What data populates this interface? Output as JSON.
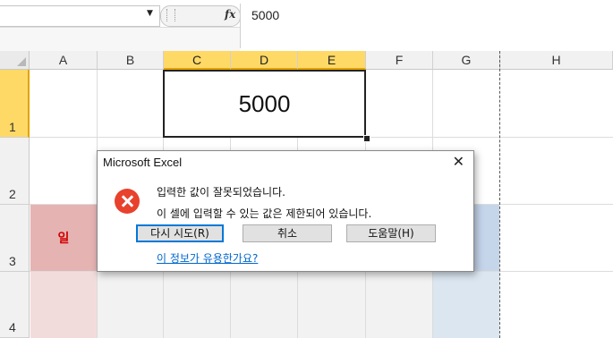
{
  "formula_bar": {
    "fx_label": "fx",
    "value": "5000"
  },
  "columns": [
    "A",
    "B",
    "C",
    "D",
    "E",
    "F",
    "G",
    "H"
  ],
  "rows": [
    "1",
    "2",
    "3",
    "4"
  ],
  "cells": {
    "C1_value": "5000",
    "A3_value": "일"
  },
  "colors": {
    "selected_header": "#ffd966",
    "pink_cell": "#e6b3b3",
    "blue_cell": "#c5d5ea",
    "error_icon": "#e8412c",
    "link": "#0066cc"
  },
  "dialog": {
    "title": "Microsoft Excel",
    "close_label": "✕",
    "icon": "error-icon",
    "message_line1": "입력한 값이 잘못되었습니다.",
    "message_line2": "이 셀에 입력할 수 있는 값은 제한되어 있습니다.",
    "retry_label": "다시 시도(R)",
    "cancel_label": "취소",
    "help_label": "도움말(H)",
    "link_label": "이 정보가 유용한가요?"
  }
}
